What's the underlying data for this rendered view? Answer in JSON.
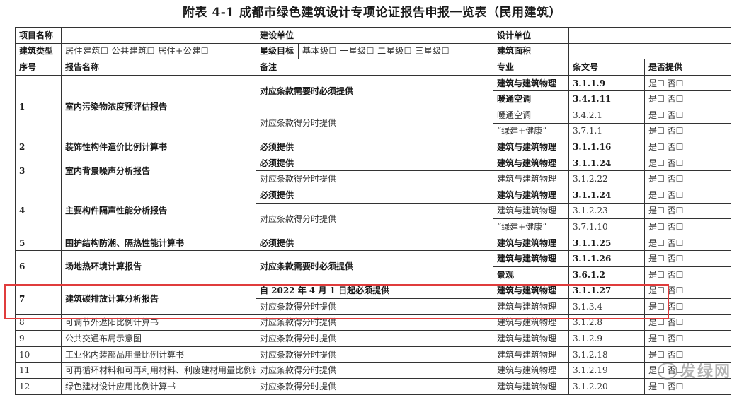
{
  "title": "附表 4-1  成都市绿色建筑设计专项论证报告申报一览表（民用建筑）",
  "info": {
    "project_name_label": "项目名称",
    "project_name_value": "",
    "build_unit_label": "建设单位",
    "build_unit_value": "",
    "design_unit_label": "设计单位",
    "design_unit_value": "",
    "building_type_label": "建筑类型",
    "building_type_options": "居住建筑☐   公共建筑☐   居住+公建☐",
    "star_goal_label": "星级目标",
    "star_goal_options": "基本级☐   一星级☐   二星级☐   三星级☐",
    "building_area_label": "建筑面积",
    "building_area_value": ""
  },
  "columns": {
    "no": "序号",
    "report": "报告名称",
    "note": "备注",
    "discipline": "专业",
    "clause": "条文号",
    "provided": "是否提供"
  },
  "yes_no": "是☐   否☐",
  "rows": [
    {
      "no": "1",
      "report": "室内污染物浓度预评估报告",
      "notes": [
        "对应条款需要时必须提供",
        "对应条款得分时提供"
      ],
      "sub": [
        [
          "建筑与建筑物理",
          "3.1.1.9"
        ],
        [
          "暖通空调",
          "3.4.1.11"
        ],
        [
          "暖通空调",
          "3.4.2.1"
        ],
        [
          "“绿建+健康”",
          "3.7.1.1"
        ]
      ]
    },
    {
      "no": "2",
      "report": "装饰性构件造价比例计算书",
      "note": "必须提供",
      "sub": [
        [
          "建筑与建筑物理",
          "3.1.1.16"
        ]
      ]
    },
    {
      "no": "3",
      "report": "室内背景噪声分析报告",
      "notes": [
        "必须提供",
        "对应条款得分时提供"
      ],
      "sub": [
        [
          "建筑与建筑物理",
          "3.1.1.24"
        ],
        [
          "建筑与建筑物理",
          "3.1.2.22"
        ]
      ]
    },
    {
      "no": "4",
      "report": "主要构件隔声性能分析报告",
      "notes": [
        "必须提供",
        "对应条款得分时提供"
      ],
      "sub": [
        [
          "建筑与建筑物理",
          "3.1.1.24"
        ],
        [
          "建筑与建筑物理",
          "3.1.2.23"
        ],
        [
          "“绿建+健康”",
          "3.7.1.10"
        ]
      ]
    },
    {
      "no": "5",
      "report": "围护结构防潮、隔热性能计算书",
      "note": "必须提供",
      "sub": [
        [
          "建筑与建筑物理",
          "3.1.1.25"
        ]
      ]
    },
    {
      "no": "6",
      "report": "场地热环境计算报告",
      "note": "对应条款需要时必须提供",
      "sub": [
        [
          "建筑与建筑物理",
          "3.1.1.26"
        ],
        [
          "景观",
          "3.6.1.2"
        ]
      ]
    },
    {
      "no": "7",
      "report": "建筑碳排放计算分析报告",
      "notes": [
        "自 2022 年 4 月 1 日起必须提供",
        "对应条款得分时提供"
      ],
      "sub": [
        [
          "建筑与建筑物理",
          "3.1.1.27"
        ],
        [
          "建筑与建筑物理",
          "3.1.3.4"
        ]
      ]
    },
    {
      "no": "8",
      "report": "可调节外遮阳比例计算书",
      "note": "对应条款得分时提供",
      "sub": [
        [
          "建筑与建筑物理",
          "3.1.2.8"
        ]
      ]
    },
    {
      "no": "9",
      "report": "公共交通布局示意图",
      "note": "对应条款得分时提供",
      "sub": [
        [
          "建筑与建筑物理",
          "3.1.2.9"
        ]
      ]
    },
    {
      "no": "10",
      "report": "工业化内装部品用量比例计算书",
      "note": "对应条款得分时提供",
      "sub": [
        [
          "建筑与建筑物理",
          "3.1.2.18"
        ]
      ]
    },
    {
      "no": "11",
      "report": "可再循环材料和可再利用材料、利废建材用量比例计算书",
      "note": "对应条款得分时提供",
      "sub": [
        [
          "建筑与建筑物理",
          "3.1.2.19"
        ]
      ]
    },
    {
      "no": "12",
      "report": "绿色建材设计应用比例计算书",
      "note": "对应条款得分时提供",
      "sub": [
        [
          "建筑与建筑物理",
          "3.1.2.20"
        ]
      ]
    }
  ],
  "watermark": "发绿网",
  "colors": {
    "highlight": "#e03c3c",
    "border": "#333333"
  }
}
